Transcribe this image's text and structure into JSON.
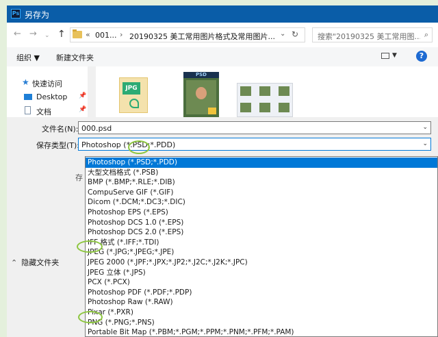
{
  "dialog": {
    "title": "另存为"
  },
  "nav": {
    "back_icon": "back-arrow-icon",
    "address": {
      "seg1": "001...",
      "seg2": "20190325 美工常用图片格式及常用图片..."
    },
    "search_placeholder": "搜索\"20190325 美工常用图..."
  },
  "toolbar": {
    "organize": "组织 ▼",
    "new_folder": "新建文件夹",
    "help": "?"
  },
  "sidebar": {
    "items": [
      {
        "label": "快速访问"
      },
      {
        "label": "Desktop"
      },
      {
        "label": "文档"
      }
    ]
  },
  "thumbs": {
    "jpg_badge": "JPG",
    "psd_badge": "PSD"
  },
  "form": {
    "filename_label": "文件名(N):",
    "filename_value": "000.psd",
    "filetype_label": "保存类型(T):",
    "filetype_value": "Photoshop (*.PSD;*.PDD)",
    "peek_text": "存",
    "hidden_folders": "隐藏文件夹"
  },
  "dropdown": {
    "options": [
      "Photoshop (*.PSD;*.PDD)",
      "大型文档格式 (*.PSB)",
      "BMP (*.BMP;*.RLE;*.DIB)",
      "CompuServe GIF (*.GIF)",
      "Dicom (*.DCM;*.DC3;*.DIC)",
      "Photoshop EPS (*.EPS)",
      "Photoshop DCS 1.0 (*.EPS)",
      "Photoshop DCS 2.0 (*.EPS)",
      "IFF 格式 (*.IFF;*.TDI)",
      "JPEG (*.JPG;*.JPEG;*.JPE)",
      "JPEG 2000 (*.JPF;*.JPX;*.JP2;*.J2C;*.J2K;*.JPC)",
      "JPEG 立体 (*.JPS)",
      "PCX (*.PCX)",
      "Photoshop PDF (*.PDF;*.PDP)",
      "Photoshop Raw (*.RAW)",
      "Pixar (*.PXR)",
      "PNG (*.PNG;*.PNS)",
      "Portable Bit Map (*.PBM;*.PGM;*.PPM;*.PNM;*.PFM;*.PAM)"
    ],
    "selected_index": 0
  },
  "colors": {
    "titlebar": "#0a5da8",
    "selection": "#0078d7",
    "highlight_ring": "#8dc63f",
    "background": "#e4f0dc"
  }
}
